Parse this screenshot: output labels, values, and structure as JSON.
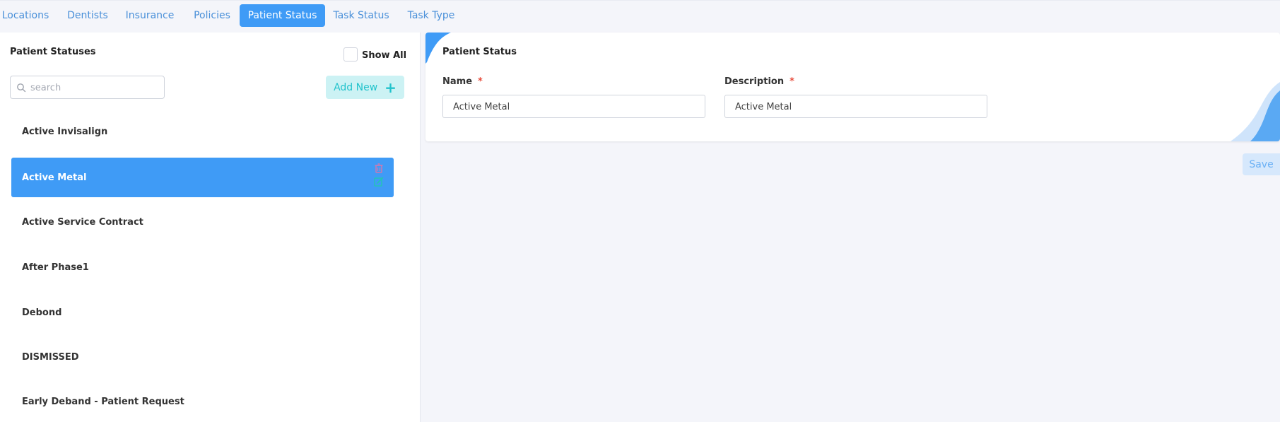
{
  "tabs": [
    {
      "label": "Locations"
    },
    {
      "label": "Dentists"
    },
    {
      "label": "Insurance"
    },
    {
      "label": "Policies"
    },
    {
      "label": "Patient Status"
    },
    {
      "label": "Task Status"
    },
    {
      "label": "Task Type"
    }
  ],
  "active_tab": "Patient Status",
  "left_panel": {
    "title": "Patient Statuses",
    "show_all_label": "Show All",
    "show_all_checked": false,
    "search_placeholder": "search",
    "add_new_label": "Add New",
    "items": [
      {
        "label": "Active Invisalign"
      },
      {
        "label": "Active Metal"
      },
      {
        "label": "Active Service Contract"
      },
      {
        "label": "After Phase1"
      },
      {
        "label": "Debond"
      },
      {
        "label": "DISMISSED"
      },
      {
        "label": "Early Deband - Patient Request"
      }
    ],
    "selected_item": "Active Metal"
  },
  "form": {
    "title": "Patient Status",
    "name_label": "Name",
    "name_value": "Active Metal",
    "description_label": "Description",
    "description_value": "Active Metal",
    "required_mark": "*",
    "save_label": "Save"
  },
  "colors": {
    "accent": "#3f9bf6",
    "add_new_bg": "#ccf2f4",
    "add_new_text": "#22c3cc",
    "required": "#e74c3c",
    "delete_icon": "#c97bb3",
    "edit_icon": "#23c4b5"
  },
  "icons": {
    "search": "search-icon",
    "add": "plus-icon",
    "delete": "trash-icon",
    "edit": "edit-icon"
  }
}
